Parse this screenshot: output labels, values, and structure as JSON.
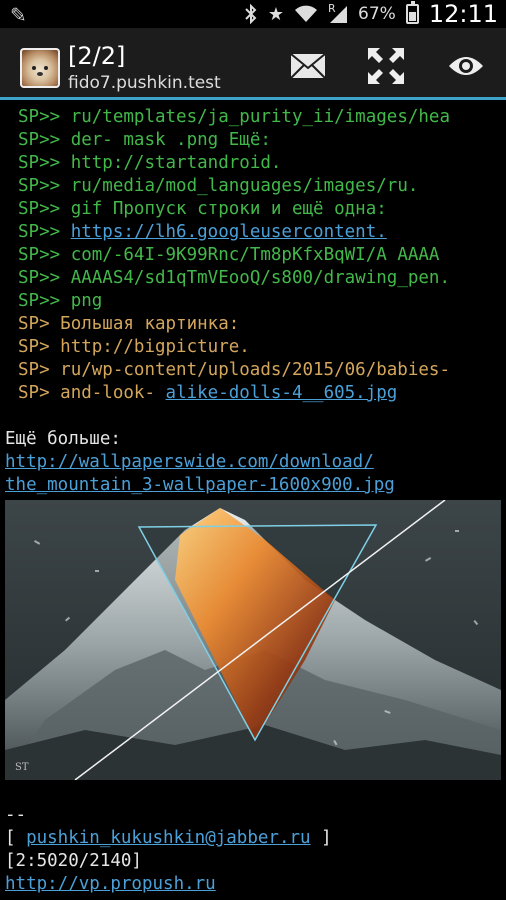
{
  "status_bar": {
    "left_icon": "pencil-icon",
    "icons": [
      "bluetooth-icon",
      "star-icon",
      "wifi-icon",
      "signal-icon"
    ],
    "signal_label": "R",
    "battery": "67%",
    "battery_level": 0.67,
    "time": "12:11"
  },
  "app_bar": {
    "title": "[2/2]",
    "subtitle": "fido7.pushkin.test",
    "actions": [
      "mail-icon",
      "fullscreen-icon",
      "eye-icon"
    ]
  },
  "quoted_sp2": [
    {
      "prefix": "SP>>",
      "text": "ru/templates/ja_purity_ii/images/hea"
    },
    {
      "prefix": "SP>>",
      "text": "der- mask .png Ещё:"
    },
    {
      "prefix": "SP>>",
      "text": "http://startandroid."
    },
    {
      "prefix": "SP>>",
      "text": "ru/media/mod_languages/images/ru."
    },
    {
      "prefix": "SP>>",
      "text": "gif Пропуск строки и ещё одна:"
    },
    {
      "prefix": "SP>>",
      "link": "https://lh6.googleusercontent."
    },
    {
      "prefix": "SP>>",
      "text": "com/-64I-9K99Rnc/Tm8pKfxBqWI/A AAAA"
    },
    {
      "prefix": "SP>>",
      "text": "AAAAS4/sd1qTmVEooQ/s800/drawing_pen."
    },
    {
      "prefix": "SP>>",
      "text": "png"
    }
  ],
  "quoted_sp1": [
    {
      "prefix": "SP>",
      "text": "Большая картинка:"
    },
    {
      "prefix": "SP>",
      "text": "http://bigpicture."
    },
    {
      "prefix": "SP>",
      "text": "ru/wp-content/uploads/2015/06/babies-"
    },
    {
      "prefix": "SP>",
      "text": "and-look-",
      "link": "alike-dolls-4__605.jpg"
    }
  ],
  "body": {
    "more_label": "Ещё больше:",
    "link_line1": "http://wallpaperswide.com/download/",
    "link_line2": "the_mountain_3-wallpaper-1600x900.jpg",
    "signature_watermark": "ST"
  },
  "footer": {
    "separator": "--",
    "bracket_open": "[ ",
    "jabber": "pushkin_kukushkin@jabber.ru",
    "bracket_close": " ]",
    "address": "[2:5020/2140]",
    "site": "http://vp.propush.ru"
  }
}
